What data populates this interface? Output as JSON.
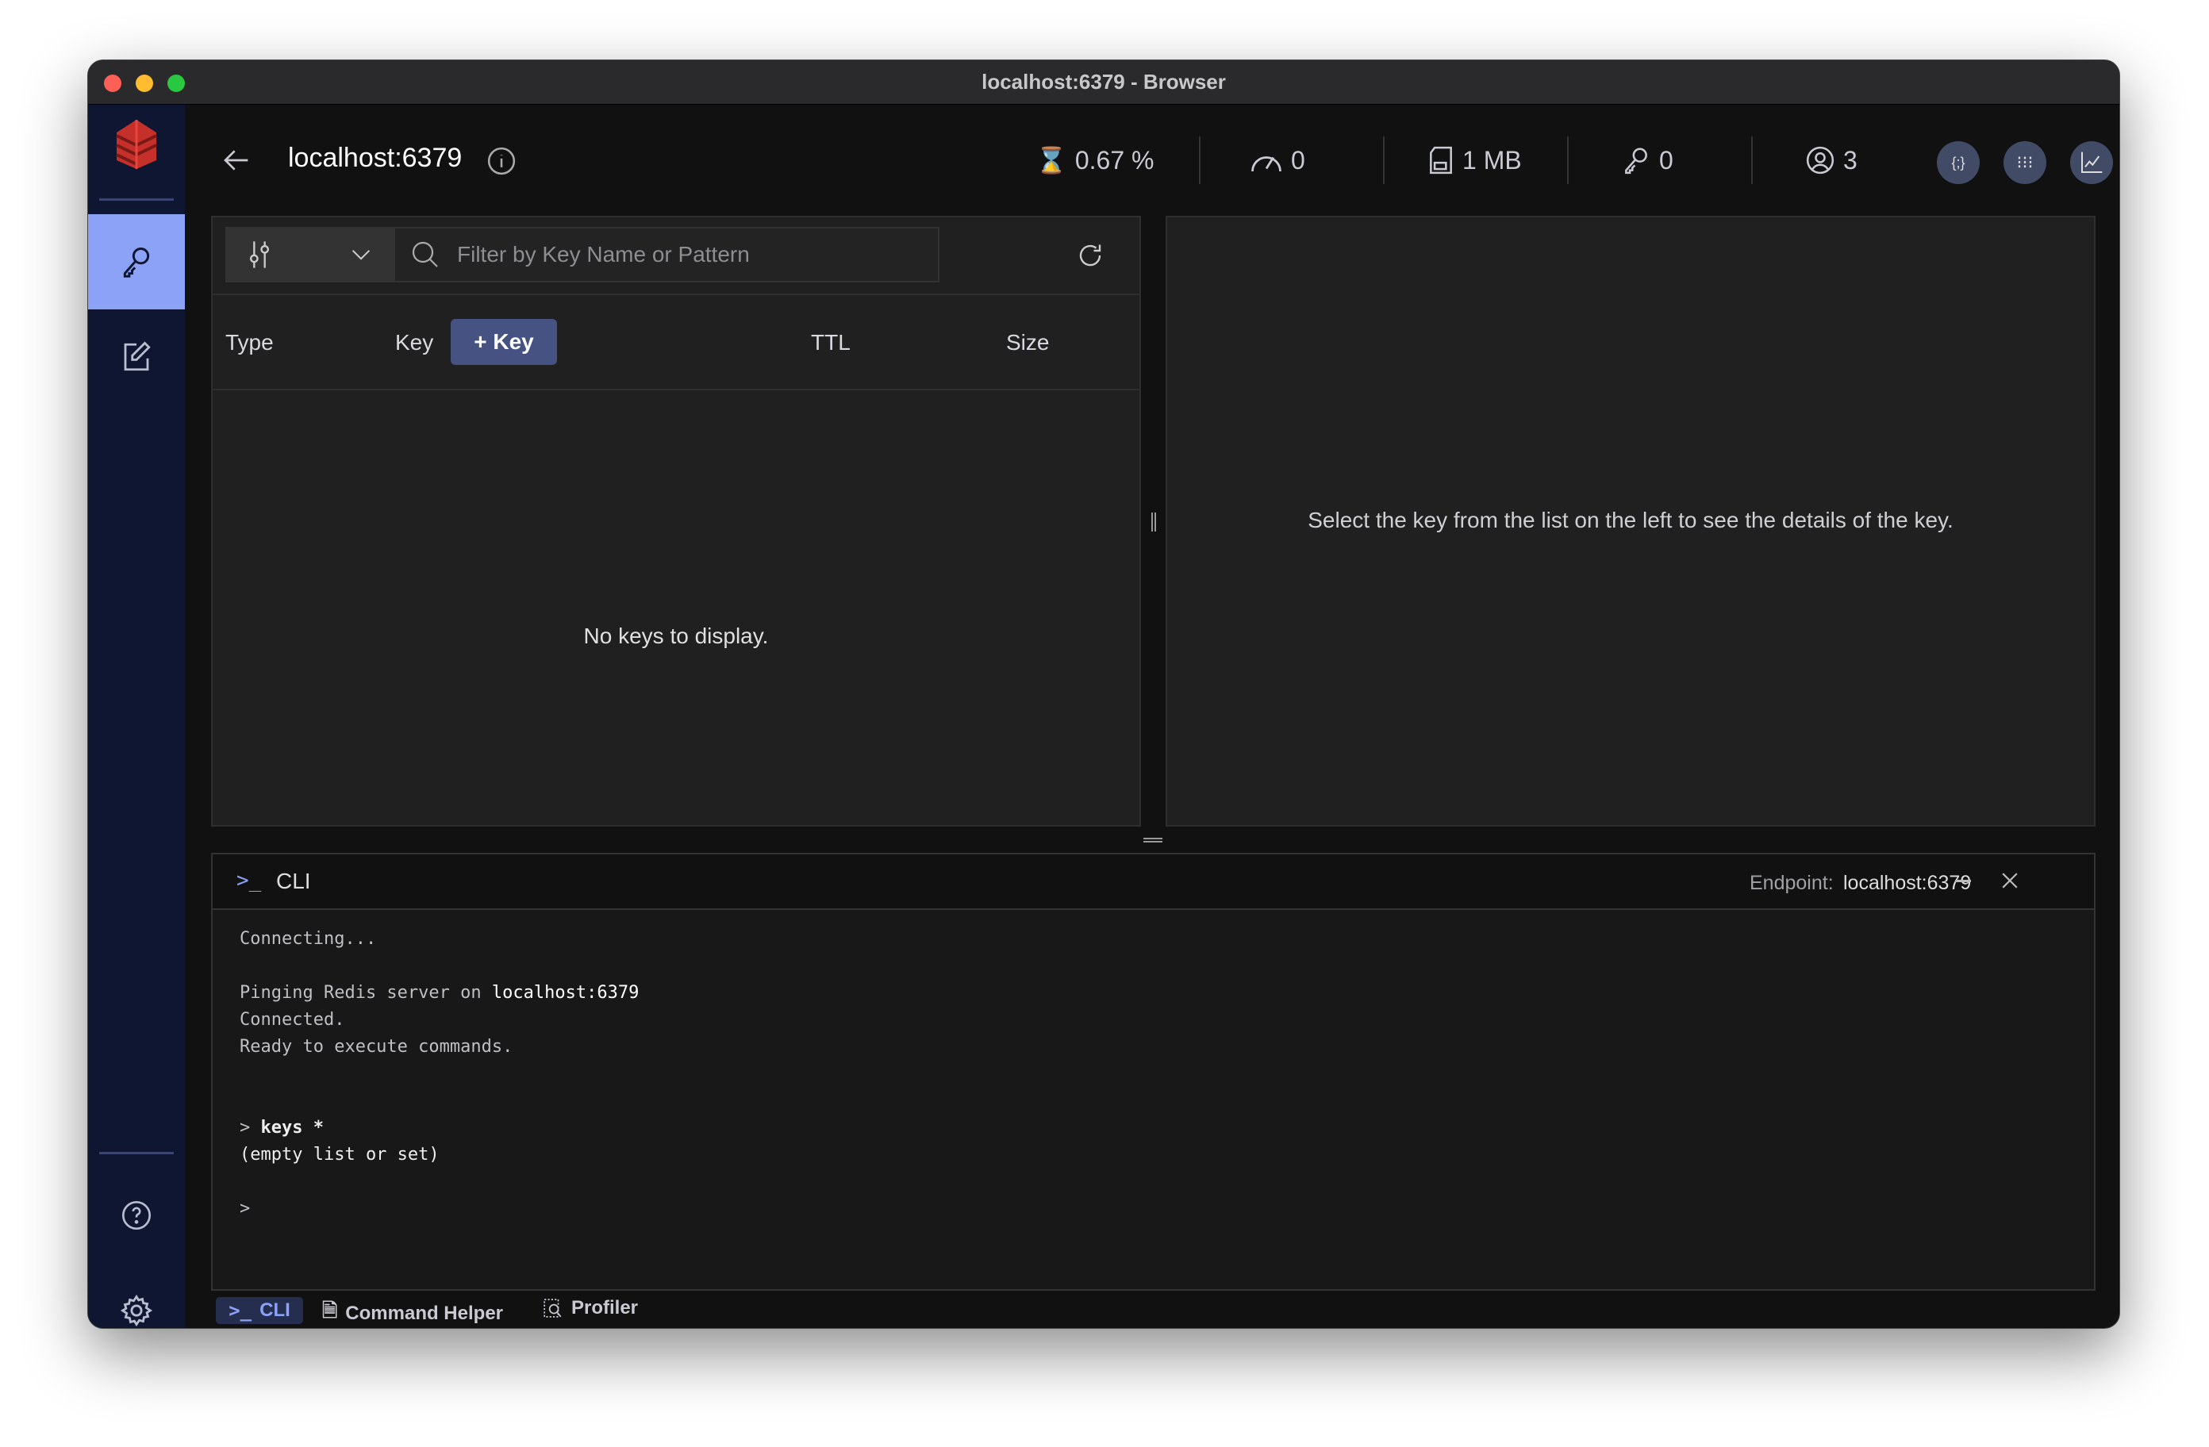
{
  "window": {
    "title": "localhost:6379 - Browser"
  },
  "header": {
    "db_name": "localhost:6379",
    "cpu": "0.67 %",
    "ops": "0",
    "memory": "1 MB",
    "keys": "0",
    "clients": "3"
  },
  "browser": {
    "filter_placeholder": "Filter by Key Name or Pattern",
    "columns": {
      "type": "Type",
      "key": "Key",
      "ttl": "TTL",
      "size": "Size"
    },
    "add_key": "+ Key",
    "empty": "No keys to display."
  },
  "details": {
    "empty": "Select the key from the list on the left to see the details of the key."
  },
  "cli": {
    "title": "CLI",
    "endpoint_label": "Endpoint:",
    "endpoint": "localhost:6379",
    "lines": {
      "connecting": "Connecting...",
      "pinging": "Pinging Redis server on ",
      "pinging_host": "localhost:6379",
      "connected": "Connected.",
      "ready": "Ready to execute commands.",
      "prompt1": "> ",
      "cmd": "keys *",
      "result": "(empty list or set)",
      "prompt2": ">"
    }
  },
  "bottom_tabs": {
    "cli": "CLI",
    "helper": "Command Helper",
    "profiler": "Profiler"
  },
  "colors": {
    "accent": "#8ba2f7",
    "sidebar": "#0f1631",
    "button": "#465282"
  }
}
